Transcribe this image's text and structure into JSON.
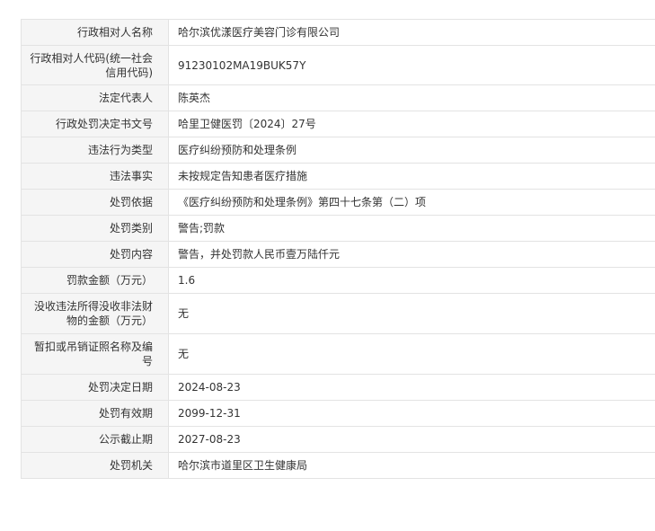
{
  "rows": [
    {
      "label": "行政相对人名称",
      "value": "哈尔滨优漾医疗美容门诊有限公司"
    },
    {
      "label": "行政相对人代码(统一社会信用代码)",
      "value": "91230102MA19BUK57Y"
    },
    {
      "label": "法定代表人",
      "value": "陈英杰"
    },
    {
      "label": "行政处罚决定书文号",
      "value": "哈里卫健医罚〔2024〕27号"
    },
    {
      "label": "违法行为类型",
      "value": "医疗纠纷预防和处理条例"
    },
    {
      "label": "违法事实",
      "value": "未按规定告知患者医疗措施"
    },
    {
      "label": "处罚依据",
      "value": "《医疗纠纷预防和处理条例》第四十七条第（二）项"
    },
    {
      "label": "处罚类别",
      "value": "警告;罚款"
    },
    {
      "label": "处罚内容",
      "value": "警告，并处罚款人民币壹万陆仟元"
    },
    {
      "label": "罚款金额（万元）",
      "value": "1.6"
    },
    {
      "label": "没收违法所得没收非法财物的金额（万元）",
      "value": "无"
    },
    {
      "label": "暂扣或吊销证照名称及编号",
      "value": "无"
    },
    {
      "label": "处罚决定日期",
      "value": "2024-08-23"
    },
    {
      "label": "处罚有效期",
      "value": "2099-12-31"
    },
    {
      "label": "公示截止期",
      "value": "2027-08-23"
    },
    {
      "label": "处罚机关",
      "value": "哈尔滨市道里区卫生健康局"
    }
  ]
}
